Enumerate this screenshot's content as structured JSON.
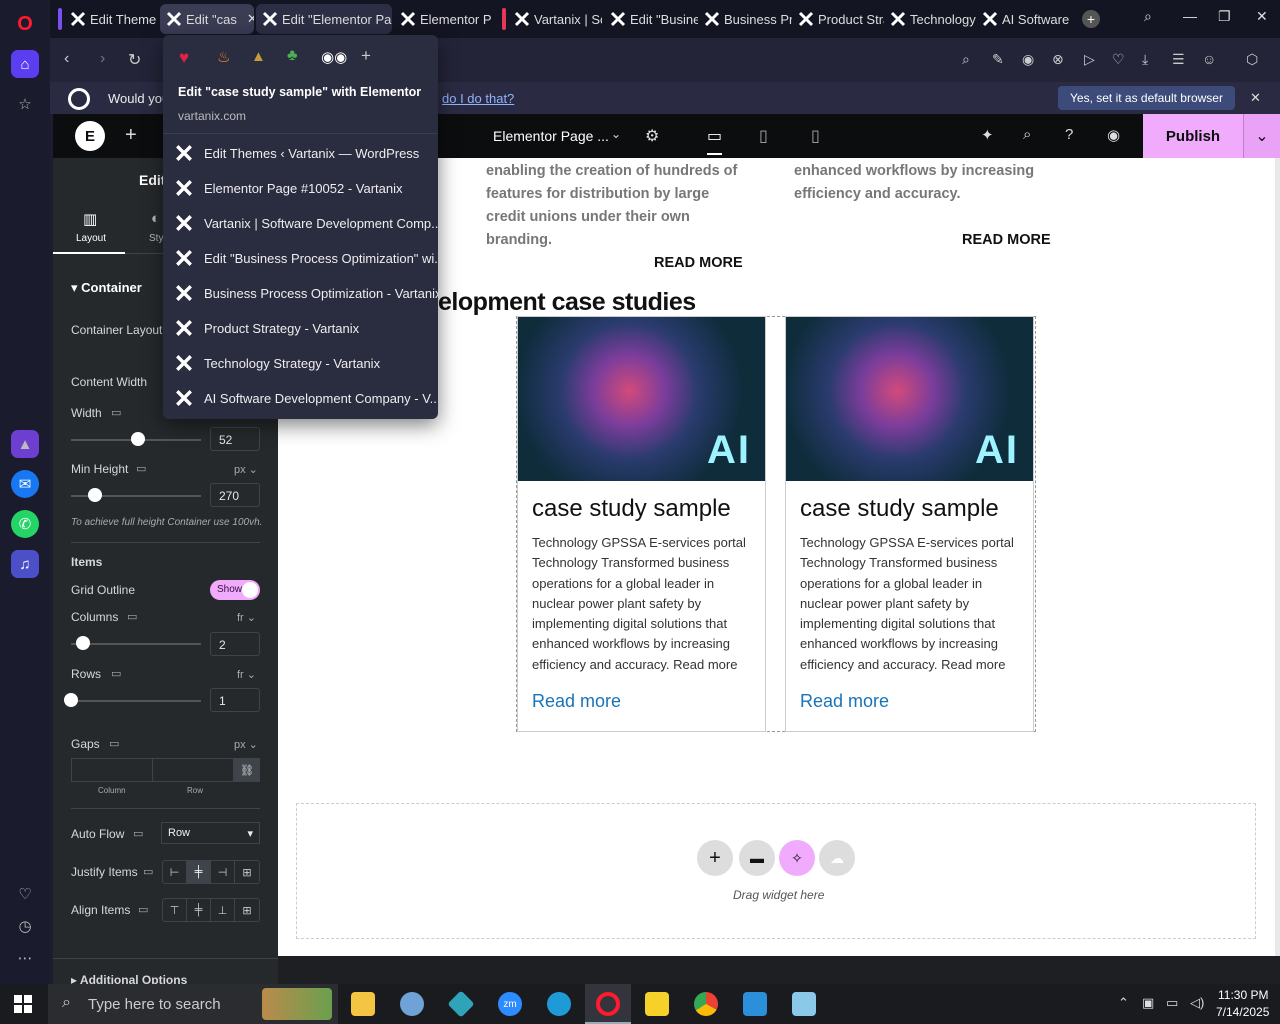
{
  "tabs": [
    {
      "label": "Edit Themes"
    },
    {
      "label": "Edit \"cas"
    },
    {
      "label": "Edit \"Elementor Page"
    },
    {
      "label": "Elementor P"
    },
    {
      "label": "Vartanix | Sc"
    },
    {
      "label": "Edit \"Busine"
    },
    {
      "label": "Business Pr"
    },
    {
      "label": "Product Stra"
    },
    {
      "label": "Technology"
    },
    {
      "label": "AI Software"
    }
  ],
  "infobar": {
    "text": "Would you",
    "link": "do I do that?",
    "button": "Yes, set it as default browser"
  },
  "popup": {
    "title": "Edit \"case study sample\" with Elementor",
    "domain": "vartanix.com",
    "items": [
      "Edit Themes ‹ Vartanix — WordPress",
      "Elementor Page #10052 - Vartanix",
      "Vartanix | Software Development Comp...",
      "Edit \"Business Process Optimization\" wi...",
      "Business Process Optimization - Vartanix",
      "Product Strategy - Vartanix",
      "Technology Strategy - Vartanix",
      "AI Software Development Company - V..."
    ]
  },
  "elementor": {
    "page_title": "Elementor Page ...",
    "publish": "Publish",
    "panel_title": "Edit",
    "tab_layout": "Layout",
    "tab_style": "Sty"
  },
  "panel": {
    "section": "Container",
    "container_layout": "Container Layout",
    "content_width": "Content Width",
    "width_label": "Width",
    "width_value": "52",
    "min_height_label": "Min Height",
    "min_height_unit": "px",
    "min_height_value": "270",
    "hint": "To achieve full height Container use 100vh.",
    "items": "Items",
    "grid_outline": "Grid Outline",
    "toggle_show": "Show",
    "columns_label": "Columns",
    "columns_unit": "fr",
    "columns_value": "2",
    "rows_label": "Rows",
    "rows_unit": "fr",
    "rows_value": "1",
    "gaps_label": "Gaps",
    "gaps_unit": "px",
    "gap_column": "Column",
    "gap_row": "Row",
    "auto_flow_label": "Auto Flow",
    "auto_flow_value": "Row",
    "justify_items": "Justify Items",
    "align_items": "Align Items",
    "additional": "Additional Options"
  },
  "canvas": {
    "text_left": "enabling the creation of hundreds of features for distribution by large credit unions under their own branding.",
    "text_right": "enhanced workflows by increasing efficiency and accuracy.",
    "read_more_left": "READ MORE",
    "read_more_right": "READ MORE",
    "heading": "elopment case studies",
    "drag_hint": "Drag widget here"
  },
  "cards": [
    {
      "title": "case study sample",
      "body": "Technology GPSSA E-services portal Technology Transformed business operations for a global leader in nuclear power plant safety by implementing digital solutions that enhanced workflows by increasing efficiency and accuracy.  Read more",
      "link": "Read more",
      "badge": "AI"
    },
    {
      "title": "case study sample",
      "body": "Technology GPSSA E-services portal Technology Transformed business operations for a global leader in nuclear power plant safety by implementing digital solutions that enhanced workflows by increasing efficiency and accuracy.  Read more",
      "link": "Read more",
      "badge": "AI"
    }
  ],
  "taskbar": {
    "search_placeholder": "Type here to search",
    "time": "11:30 PM",
    "date": "7/14/2025"
  },
  "colors": {
    "accent": "#f0abfc",
    "link": "#1874b8",
    "panel_bg": "#26292c"
  }
}
